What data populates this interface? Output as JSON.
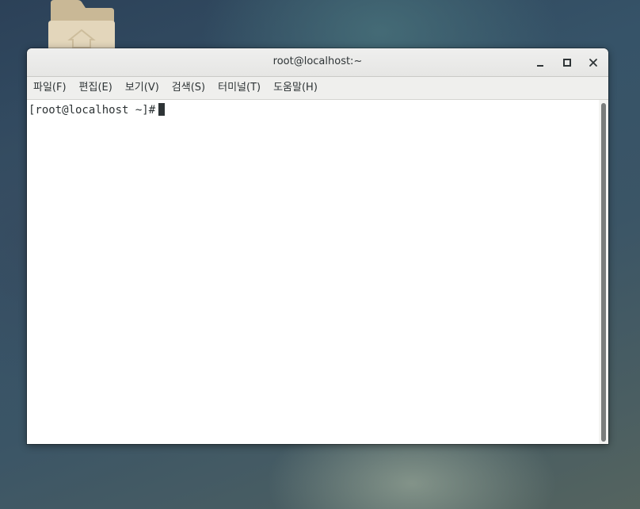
{
  "window": {
    "title": "root@localhost:~",
    "controls": {
      "minimize_icon": "minimize-icon",
      "maximize_icon": "maximize-icon",
      "close_icon": "close-icon"
    }
  },
  "menubar": {
    "items": [
      {
        "label": "파일(F)"
      },
      {
        "label": "편집(E)"
      },
      {
        "label": "보기(V)"
      },
      {
        "label": "검색(S)"
      },
      {
        "label": "터미널(T)"
      },
      {
        "label": "도움말(H)"
      }
    ]
  },
  "terminal": {
    "prompt": "[root@localhost ~]#"
  },
  "desktop": {
    "icon": "home-folder-icon"
  },
  "colors": {
    "titlebar": "#e8e8e6",
    "menubar": "#efefed",
    "terminal_bg": "#ffffff",
    "text": "#2e3436",
    "scroll_thumb": "#7a7d7c"
  }
}
